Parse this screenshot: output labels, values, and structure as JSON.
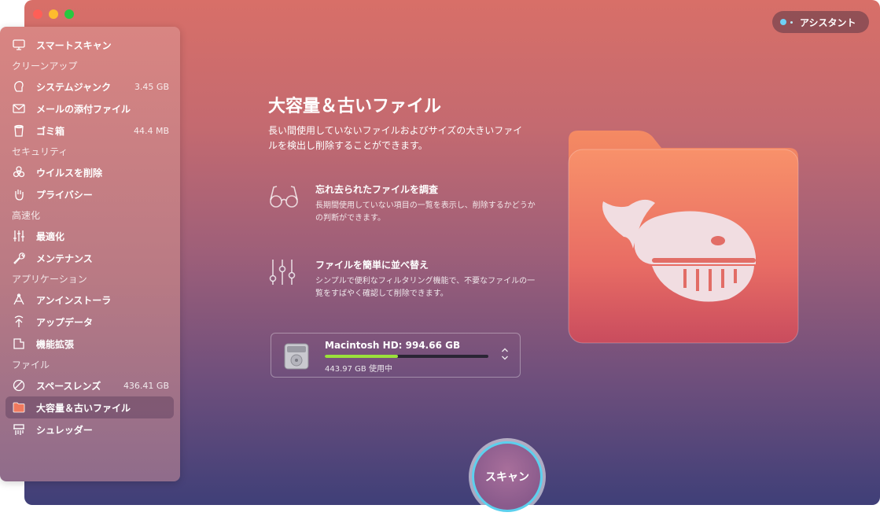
{
  "assistant": {
    "label": "アシスタント"
  },
  "sidebar": {
    "top_item": {
      "label": "スマートスキャン",
      "icon": "monitor-icon"
    },
    "sections": [
      {
        "header": "クリーンアップ",
        "items": [
          {
            "label": "システムジャンク",
            "value": "3.45 GB",
            "icon": "system-junk-icon"
          },
          {
            "label": "メールの添付ファイル",
            "value": "",
            "icon": "mail-icon"
          },
          {
            "label": "ゴミ箱",
            "value": "44.4 MB",
            "icon": "trash-icon"
          }
        ]
      },
      {
        "header": "セキュリティ",
        "items": [
          {
            "label": "ウイルスを削除",
            "value": "",
            "icon": "biohazard-icon"
          },
          {
            "label": "プライバシー",
            "value": "",
            "icon": "hand-icon"
          }
        ]
      },
      {
        "header": "高速化",
        "items": [
          {
            "label": "最適化",
            "value": "",
            "icon": "sliders-icon"
          },
          {
            "label": "メンテナンス",
            "value": "",
            "icon": "wrench-icon"
          }
        ]
      },
      {
        "header": "アプリケーション",
        "items": [
          {
            "label": "アンインストーラ",
            "value": "",
            "icon": "uninstaller-icon"
          },
          {
            "label": "アップデータ",
            "value": "",
            "icon": "updater-icon"
          },
          {
            "label": "機能拡張",
            "value": "",
            "icon": "extensions-icon"
          }
        ]
      },
      {
        "header": "ファイル",
        "items": [
          {
            "label": "スペースレンズ",
            "value": "436.41 GB",
            "icon": "space-lens-icon"
          },
          {
            "label": "大容量＆古いファイル",
            "value": "",
            "icon": "folder-icon",
            "active": true
          },
          {
            "label": "シュレッダー",
            "value": "",
            "icon": "shredder-icon"
          }
        ]
      }
    ]
  },
  "main": {
    "title": "大容量＆古いファイル",
    "description": "長い間使用していないファイルおよびサイズの大きいファイルを検出し削除することができます。",
    "features": [
      {
        "title": "忘れ去られたファイルを調査",
        "desc": "長期間使用していない項目の一覧を表示し、削除するかどうかの判断ができます。",
        "icon": "glasses-icon"
      },
      {
        "title": "ファイルを簡単に並べ替え",
        "desc": "シンプルで便利なフィルタリング機能で、不要なファイルの一覧をすばやく確認して削除できます。",
        "icon": "filter-sliders-icon"
      }
    ],
    "disk": {
      "name": "Macintosh HD: 994.66 GB",
      "used": "443.97 GB 使用中",
      "used_fraction": 0.446
    },
    "scan_label": "スキャン"
  },
  "colors": {
    "accent_ring": "#5cd0ee",
    "disk_fill": "#9be13c",
    "folder": "#f0795e"
  }
}
